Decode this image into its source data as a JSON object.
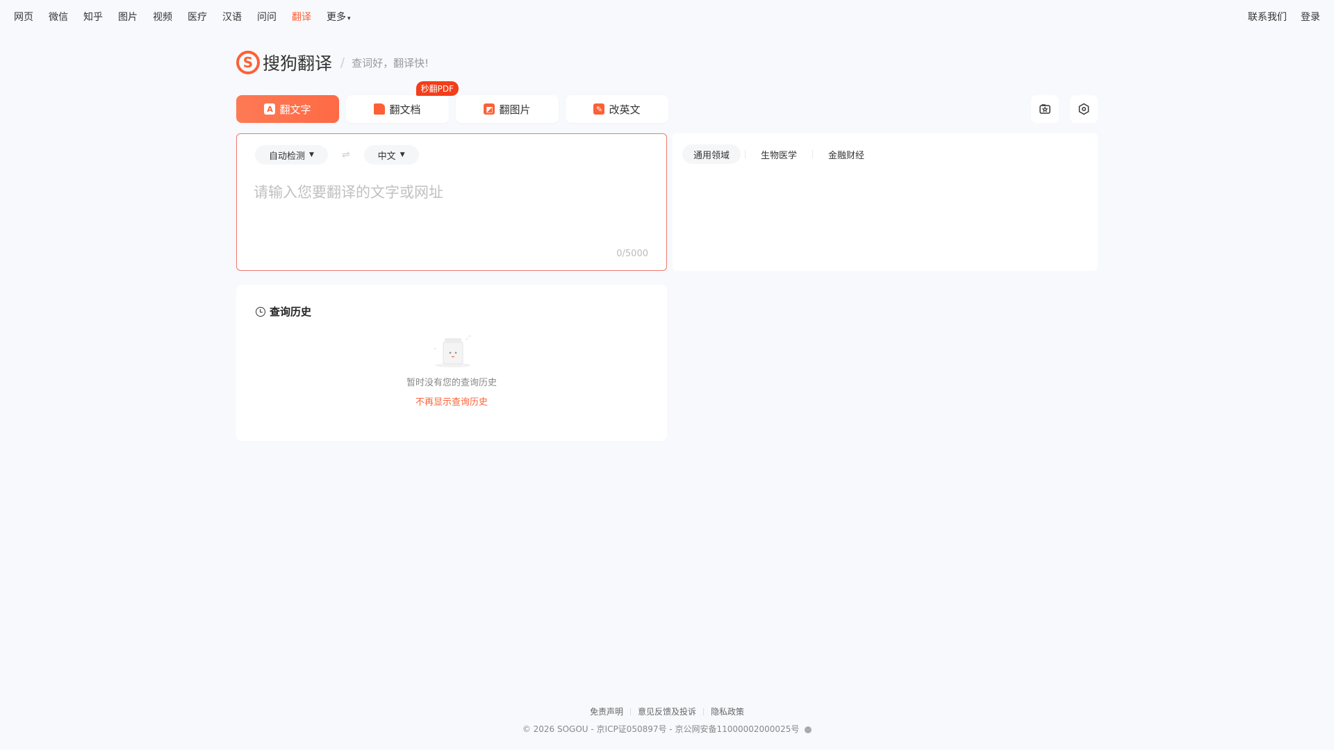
{
  "topnav": {
    "items": [
      "网页",
      "微信",
      "知乎",
      "图片",
      "视频",
      "医疗",
      "汉语",
      "问问",
      "翻译",
      "更多"
    ],
    "active": "翻译",
    "right": [
      "联系我们",
      "登录"
    ]
  },
  "logo": {
    "text": "搜狗翻译",
    "slogan": "查词好，翻译快!"
  },
  "tabs": [
    {
      "label": "翻文字",
      "active": true
    },
    {
      "label": "翻文档",
      "badge": "秒翻PDF"
    },
    {
      "label": "翻图片"
    },
    {
      "label": "改英文"
    }
  ],
  "input": {
    "source_lang": "自动检测",
    "target_lang": "中文",
    "placeholder": "请输入您要翻译的文字或网址",
    "count": "0/5000"
  },
  "domains": [
    "通用领域",
    "生物医学",
    "金融财经"
  ],
  "history": {
    "title": "查询历史",
    "empty": "暂时没有您的查询历史",
    "hide": "不再显示查询历史"
  },
  "footer": {
    "links": [
      "免责声明",
      "意见反馈及投诉",
      "隐私政策"
    ],
    "copyright": "© 2026 SOGOU - 京ICP证050897号 - 京公网安备11000002000025号"
  },
  "colors": {
    "accent": "#fd6036",
    "background": "#f7f9fc"
  }
}
